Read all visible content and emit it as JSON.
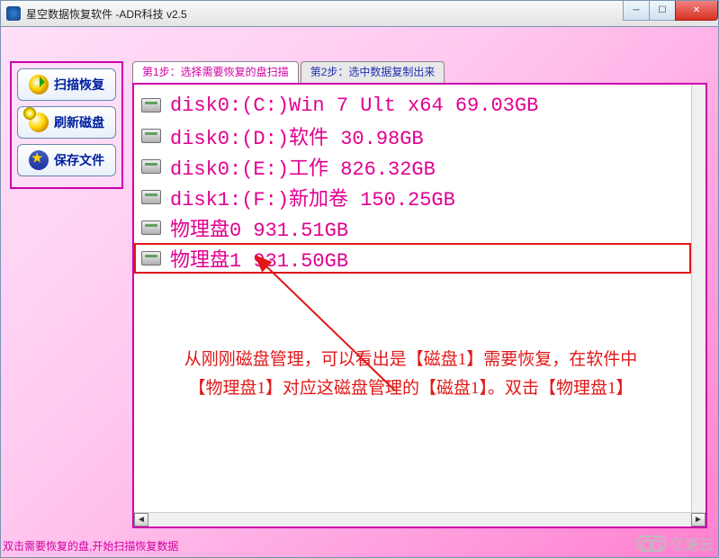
{
  "window": {
    "title": "星空数据恢复软件   -ADR科技 v2.5"
  },
  "sidebar": {
    "scan_label": "扫描恢复",
    "refresh_label": "刷新磁盘",
    "save_label": "保存文件"
  },
  "tabs": {
    "step1": "第1步：选择需要恢复的盘扫描",
    "step2": "第2步：选中数据复制出来"
  },
  "disks": [
    {
      "label": "disk0:(C:)Win 7 Ult x64 69.03GB"
    },
    {
      "label": "disk0:(D:)软件 30.98GB"
    },
    {
      "label": "disk0:(E:)工作 826.32GB"
    },
    {
      "label": "disk1:(F:)新加卷 150.25GB"
    },
    {
      "label": "物理盘0 931.51GB"
    },
    {
      "label": "物理盘1 931.50GB",
      "highlighted": true
    }
  ],
  "annotation": {
    "line1": "从刚刚磁盘管理，可以看出是【磁盘1】需要恢复，在软件中",
    "line2": "【物理盘1】对应这磁盘管理的【磁盘1】。双击【物理盘1】"
  },
  "statusbar": "双击需要恢复的盘,开始扫描恢复数据",
  "watermark": "亿速云",
  "colors": {
    "accent": "#cc00aa",
    "highlight": "#e01818"
  }
}
